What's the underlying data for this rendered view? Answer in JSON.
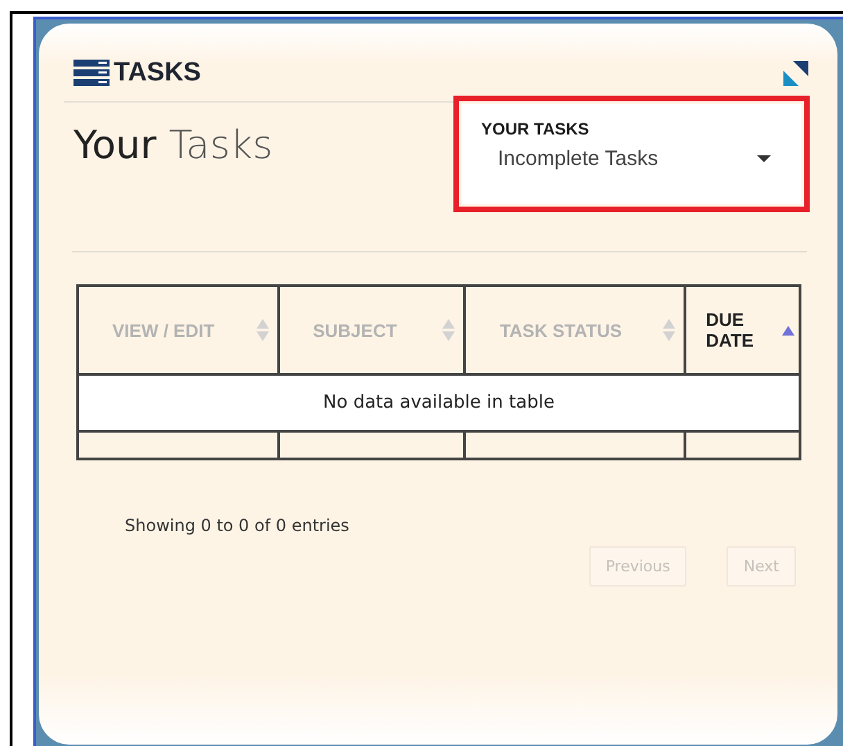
{
  "widget": {
    "title": "TASKS"
  },
  "heading": {
    "strong": "Your",
    "light": "Tasks"
  },
  "filter": {
    "label": "YOUR TASKS",
    "value": "Incomplete Tasks",
    "highlighted": true
  },
  "table": {
    "columns": [
      {
        "label": "VIEW / EDIT",
        "sorted": false
      },
      {
        "label": "SUBJECT",
        "sorted": false
      },
      {
        "label": "TASK STATUS",
        "sorted": false
      },
      {
        "label": "DUE DATE",
        "sorted": true
      }
    ],
    "empty_message": "No data available in table"
  },
  "info": "Showing 0 to 0 of 0 entries",
  "pagination": [
    {
      "label": "Previous",
      "disabled": true
    },
    {
      "label": "Next",
      "disabled": true
    }
  ]
}
